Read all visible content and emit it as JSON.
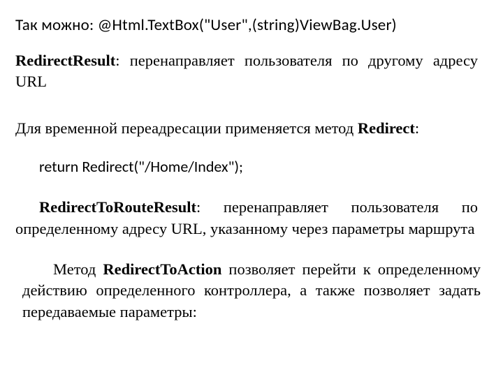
{
  "intro": {
    "prefix": "Так можно:  ",
    "code": "@Html.TextBox(\"User\",(string)ViewBag.User)"
  },
  "redirectResult": {
    "boldTerm": "RedirectResult",
    "rest": ": перенаправляет пользователя по другому адресу URL"
  },
  "temporal": {
    "prefix": "Для временной переадресации применяется метод ",
    "boldTerm": "Redirect",
    "suffix": ":"
  },
  "codeLine": "return Redirect(\"/Home/Index\");",
  "rtrr": {
    "boldTerm": "RedirectToRouteResult",
    "rest": ": перенаправляет пользователя по определенному адресу URL, указанному через параметры маршрута"
  },
  "rta": {
    "prefix": "Метод ",
    "boldTerm": "RedirectToAction",
    "suffix": " позволяет перейти к определенному действию определенного контроллера, а также позволяет задать передаваемые параметры:"
  }
}
